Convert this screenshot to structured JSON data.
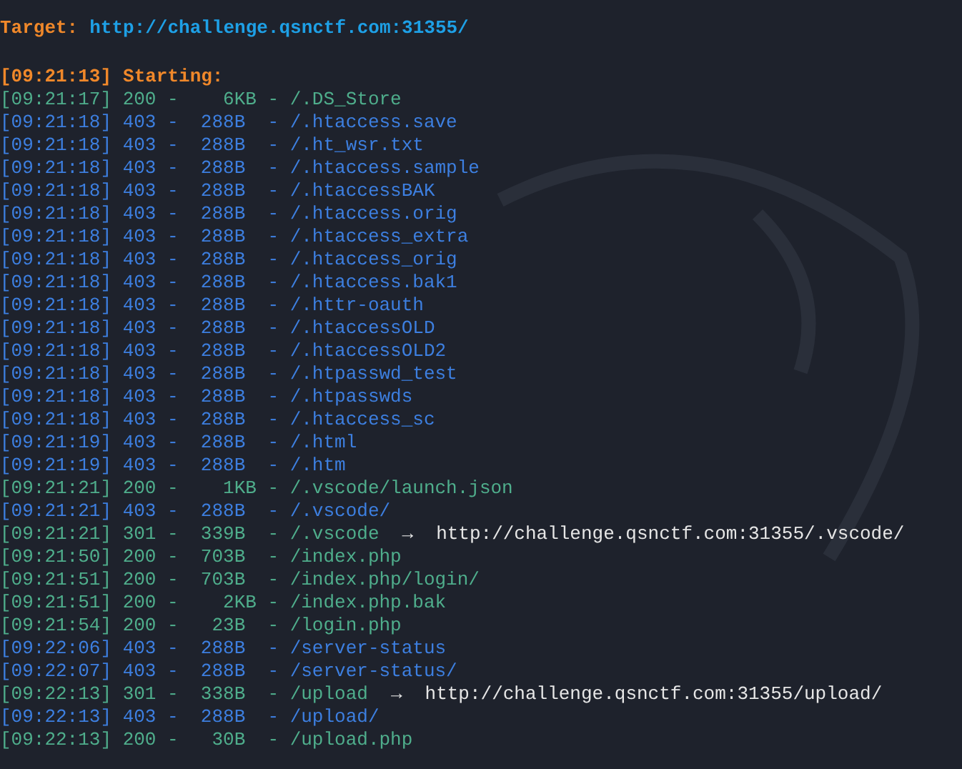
{
  "target": {
    "label": "Target:",
    "url": "http://challenge.qsnctf.com:31355/"
  },
  "start": {
    "time": "[09:21:13]",
    "text": "Starting:"
  },
  "log": [
    {
      "kind": "ok",
      "text": "[09:21:17] 200 -    6KB - /.DS_Store"
    },
    {
      "kind": "forbidden",
      "text": "[09:21:18] 403 -  288B  - /.htaccess.save"
    },
    {
      "kind": "forbidden",
      "text": "[09:21:18] 403 -  288B  - /.ht_wsr.txt"
    },
    {
      "kind": "forbidden",
      "text": "[09:21:18] 403 -  288B  - /.htaccess.sample"
    },
    {
      "kind": "forbidden",
      "text": "[09:21:18] 403 -  288B  - /.htaccessBAK"
    },
    {
      "kind": "forbidden",
      "text": "[09:21:18] 403 -  288B  - /.htaccess.orig"
    },
    {
      "kind": "forbidden",
      "text": "[09:21:18] 403 -  288B  - /.htaccess_extra"
    },
    {
      "kind": "forbidden",
      "text": "[09:21:18] 403 -  288B  - /.htaccess_orig"
    },
    {
      "kind": "forbidden",
      "text": "[09:21:18] 403 -  288B  - /.htaccess.bak1"
    },
    {
      "kind": "forbidden",
      "text": "[09:21:18] 403 -  288B  - /.httr-oauth"
    },
    {
      "kind": "forbidden",
      "text": "[09:21:18] 403 -  288B  - /.htaccessOLD"
    },
    {
      "kind": "forbidden",
      "text": "[09:21:18] 403 -  288B  - /.htaccessOLD2"
    },
    {
      "kind": "forbidden",
      "text": "[09:21:18] 403 -  288B  - /.htpasswd_test"
    },
    {
      "kind": "forbidden",
      "text": "[09:21:18] 403 -  288B  - /.htpasswds"
    },
    {
      "kind": "forbidden",
      "text": "[09:21:18] 403 -  288B  - /.htaccess_sc"
    },
    {
      "kind": "forbidden",
      "text": "[09:21:19] 403 -  288B  - /.html"
    },
    {
      "kind": "forbidden",
      "text": "[09:21:19] 403 -  288B  - /.htm"
    },
    {
      "kind": "ok",
      "text": "[09:21:21] 200 -    1KB - /.vscode/launch.json"
    },
    {
      "kind": "forbidden",
      "text": "[09:21:21] 403 -  288B  - /.vscode/"
    },
    {
      "kind": "redirect",
      "text": "[09:21:21] 301 -  339B  - /.vscode",
      "arrow": "→",
      "location": "http://challenge.qsnctf.com:31355/.vscode/"
    },
    {
      "kind": "ok",
      "text": "[09:21:50] 200 -  703B  - /index.php"
    },
    {
      "kind": "ok",
      "text": "[09:21:51] 200 -  703B  - /index.php/login/"
    },
    {
      "kind": "ok",
      "text": "[09:21:51] 200 -    2KB - /index.php.bak"
    },
    {
      "kind": "ok",
      "text": "[09:21:54] 200 -   23B  - /login.php"
    },
    {
      "kind": "forbidden",
      "text": "[09:22:06] 403 -  288B  - /server-status"
    },
    {
      "kind": "forbidden",
      "text": "[09:22:07] 403 -  288B  - /server-status/"
    },
    {
      "kind": "redirect",
      "text": "[09:22:13] 301 -  338B  - /upload",
      "arrow": "→",
      "location": "http://challenge.qsnctf.com:31355/upload/"
    },
    {
      "kind": "forbidden",
      "text": "[09:22:13] 403 -  288B  - /upload/"
    },
    {
      "kind": "ok",
      "text": "[09:22:13] 200 -   30B  - /upload.php"
    }
  ]
}
